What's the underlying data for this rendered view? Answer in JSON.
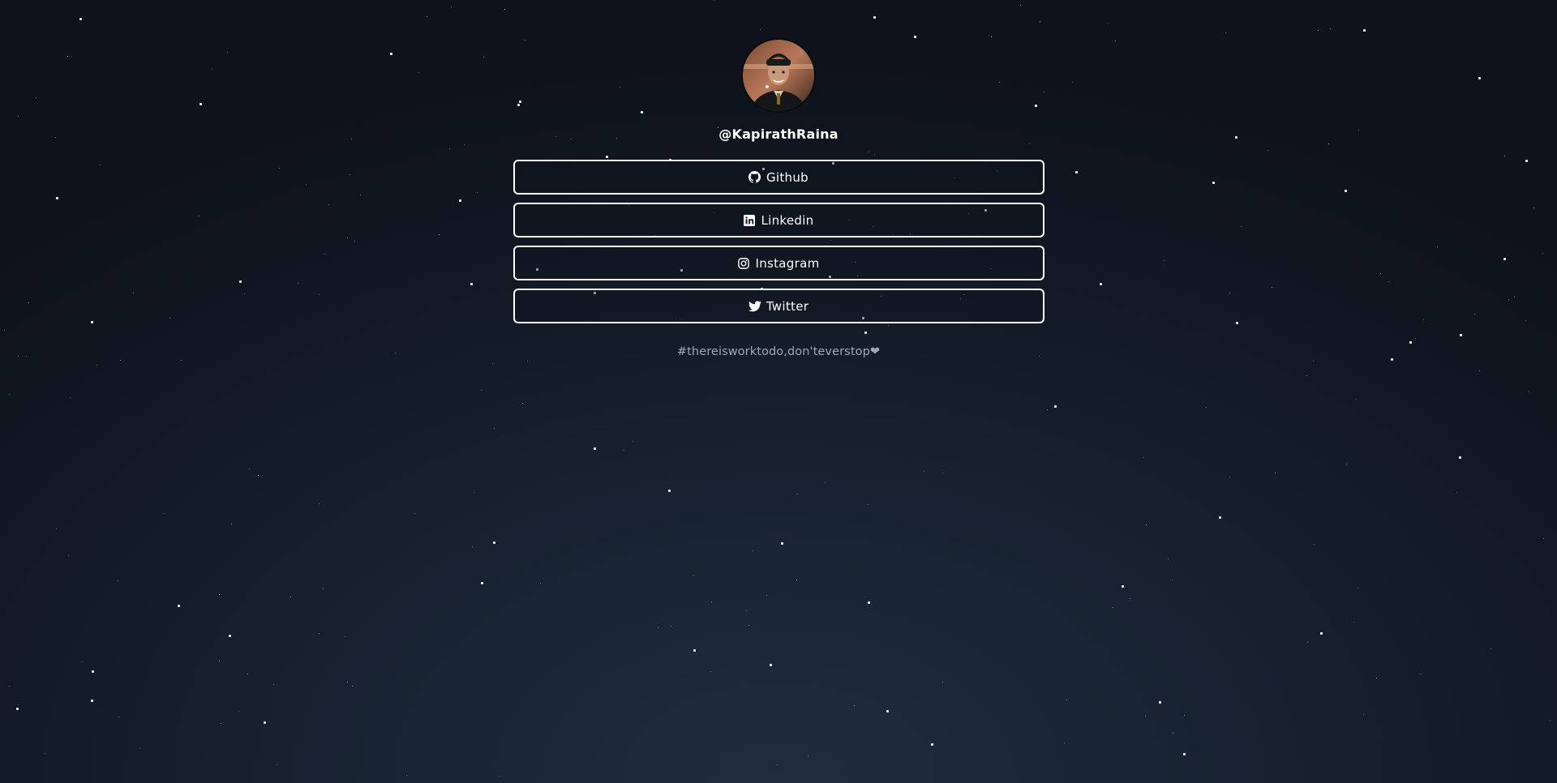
{
  "profile": {
    "handle": "@KapirathRaina",
    "avatar_icon": "profile-photo"
  },
  "links": [
    {
      "label": "Github",
      "icon": "github-icon"
    },
    {
      "label": "Linkedin",
      "icon": "linkedin-icon"
    },
    {
      "label": "Instagram",
      "icon": "instagram-icon"
    },
    {
      "label": "Twitter",
      "icon": "twitter-icon"
    }
  ],
  "footer": {
    "tagline": "#thereisworktodo,don'teverstop",
    "heart": "❤"
  },
  "colors": {
    "background_top": "#0d121b",
    "background_bottom": "#1f2d3e",
    "button_border": "#ffffff",
    "tagline": "#a3a9b2"
  }
}
